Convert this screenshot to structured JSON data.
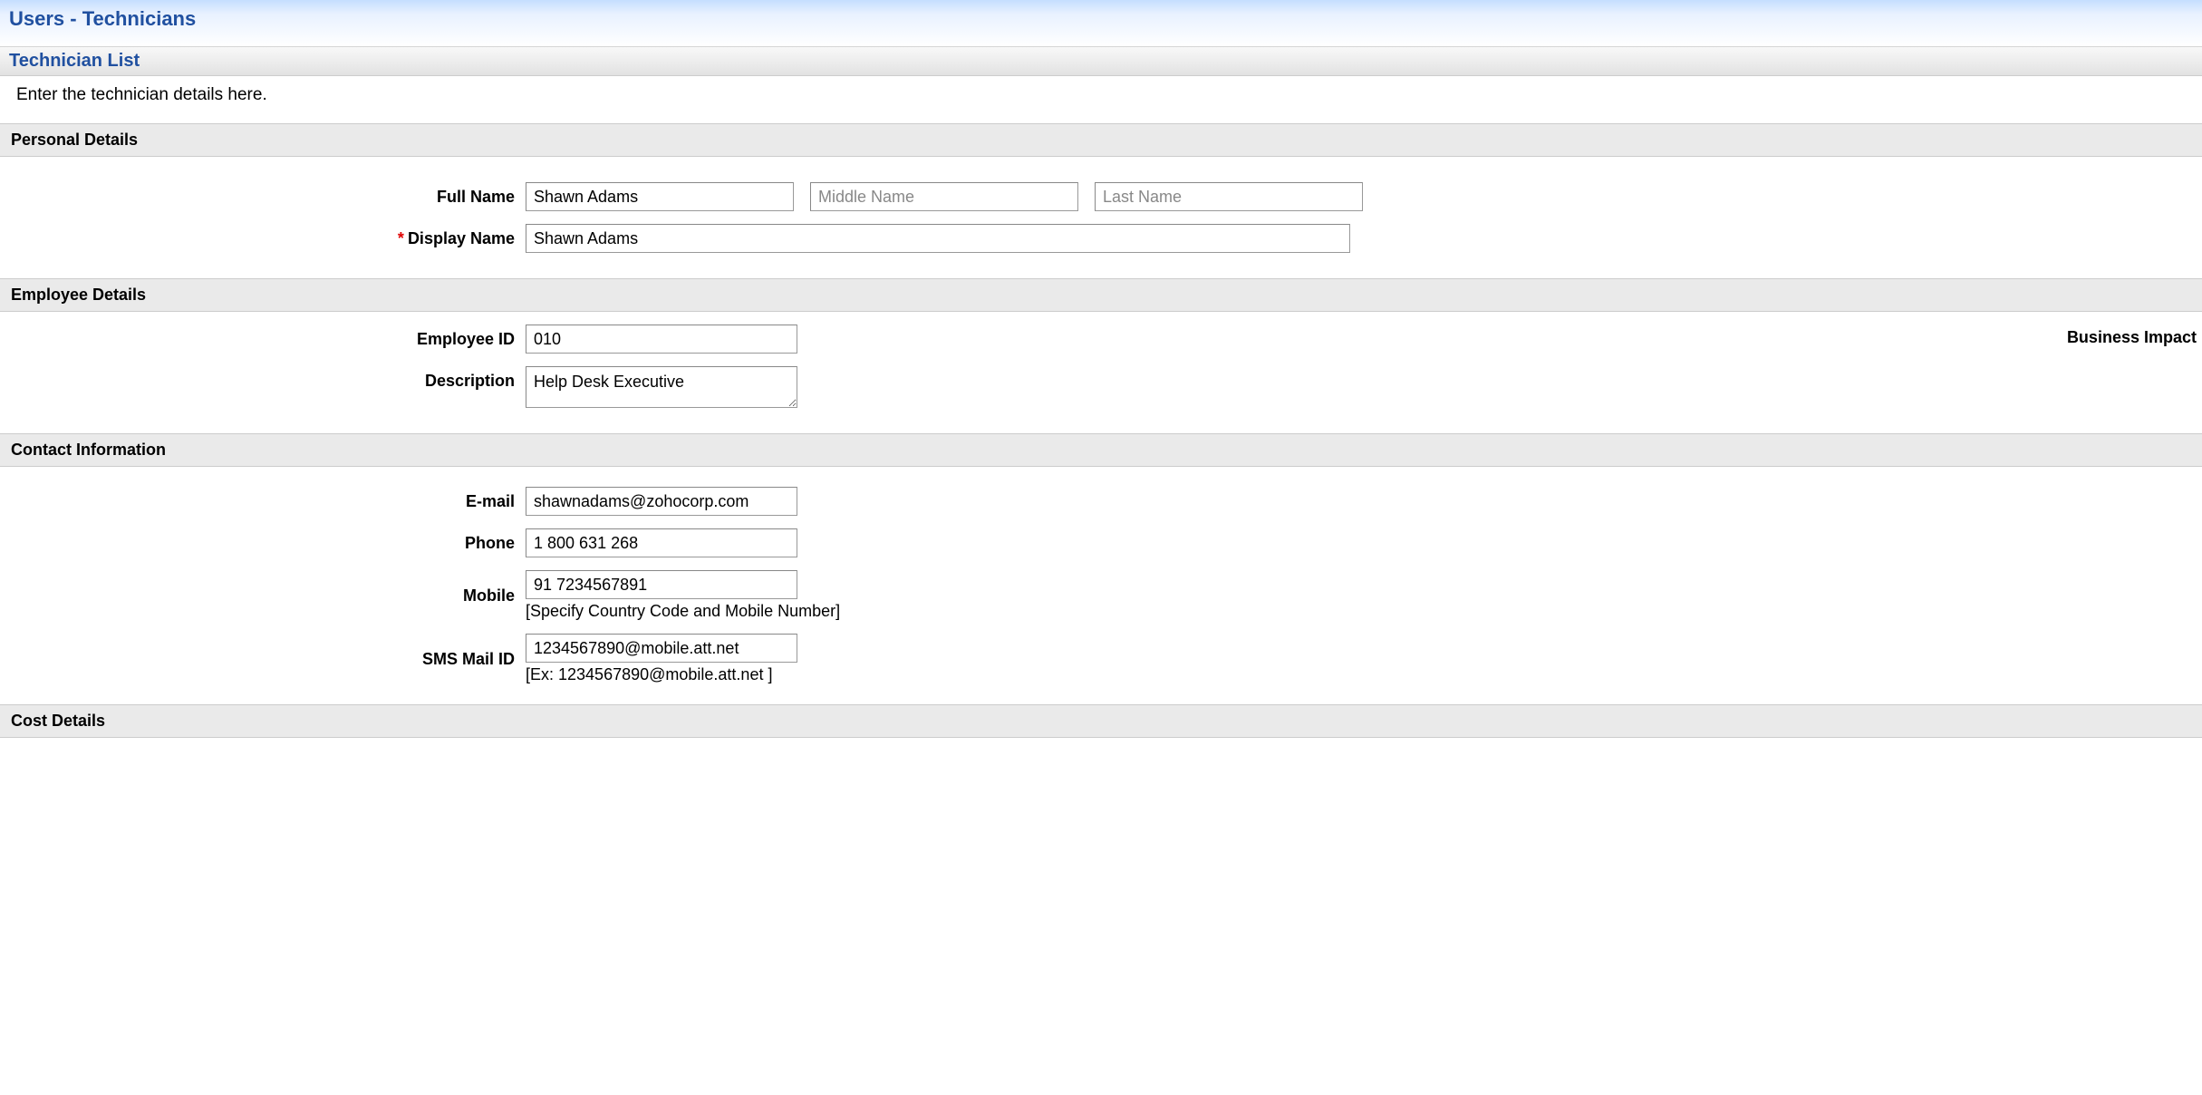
{
  "header": {
    "page_title": "Users - Technicians",
    "sub_title": "Technician List"
  },
  "instruction": "Enter the technician details here.",
  "sections": {
    "personal": {
      "title": "Personal Details",
      "full_name_label": "Full Name",
      "first_name_value": "Shawn Adams",
      "middle_name_placeholder": "Middle Name",
      "middle_name_value": "",
      "last_name_placeholder": "Last Name",
      "last_name_value": "",
      "display_name_label": "Display Name",
      "display_name_value": "Shawn Adams"
    },
    "employee": {
      "title": "Employee Details",
      "employee_id_label": "Employee ID",
      "employee_id_value": "010",
      "description_label": "Description",
      "description_value": "Help Desk Executive",
      "business_impact_label": "Business Impact"
    },
    "contact": {
      "title": "Contact Information",
      "email_label": "E-mail",
      "email_value": "shawnadams@zohocorp.com",
      "phone_label": "Phone",
      "phone_value": "1 800 631 268",
      "mobile_label": "Mobile",
      "mobile_value": "91 7234567891",
      "mobile_hint": "[Specify Country Code and Mobile Number]",
      "sms_label": "SMS Mail ID",
      "sms_value": "1234567890@mobile.att.net",
      "sms_hint": "[Ex: 1234567890@mobile.att.net ]"
    },
    "cost": {
      "title": "Cost Details"
    }
  }
}
